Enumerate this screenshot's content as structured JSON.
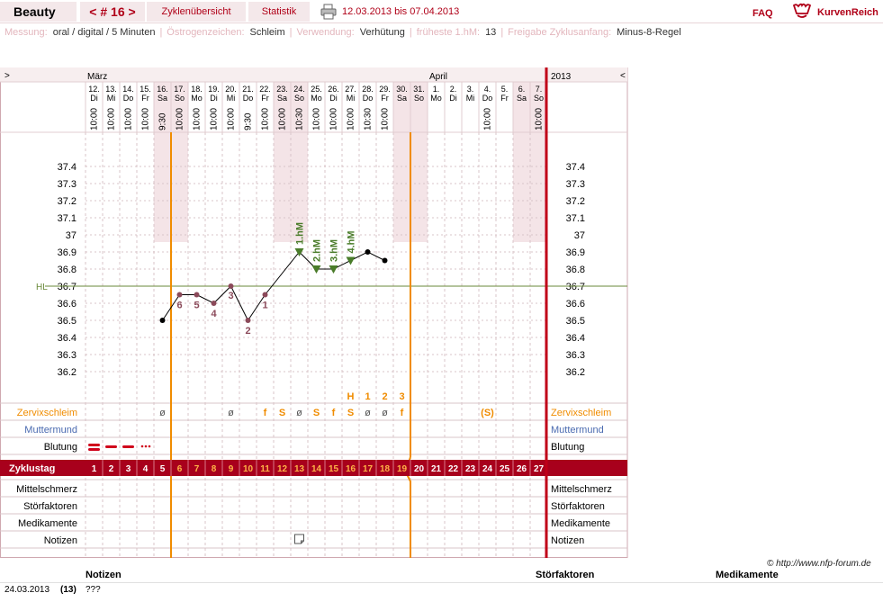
{
  "topbar": {
    "app_title": "Beauty",
    "cycle_label": "< # 16 >",
    "tab_overview": "Zyklenübersicht",
    "tab_statistics": "Statistik",
    "date_range": "12.03.2013 bis 07.04.2013",
    "faq": "FAQ",
    "logo_text": "KurvenReich"
  },
  "meta": [
    {
      "key": "Messung:",
      "value": "oral / digital / 5 Minuten"
    },
    {
      "key": "Östrogenzeichen:",
      "value": "Schleim"
    },
    {
      "key": "Verwendung:",
      "value": "Verhütung"
    },
    {
      "key": "früheste 1.hM:",
      "value": "13"
    },
    {
      "key": "Freigabe Zyklusanfang:",
      "value": "Minus-8-Regel"
    }
  ],
  "chart_data": {
    "type": "line",
    "nav_left": ">",
    "nav_right": "<",
    "year": "2013",
    "months": [
      {
        "label": "März",
        "day_index": 0
      },
      {
        "label": "April",
        "day_index": 20
      }
    ],
    "days": [
      {
        "date": "12.",
        "wd": "Di",
        "time": "10:00",
        "cd": "1",
        "weekend": false
      },
      {
        "date": "13.",
        "wd": "Mi",
        "time": "10:00",
        "cd": "2",
        "weekend": false
      },
      {
        "date": "14.",
        "wd": "Do",
        "time": "10:00",
        "cd": "3",
        "weekend": false
      },
      {
        "date": "15.",
        "wd": "Fr",
        "time": "10:00",
        "cd": "4",
        "weekend": false
      },
      {
        "date": "16.",
        "wd": "Sa",
        "time": "9:30",
        "cd": "5",
        "weekend": true
      },
      {
        "date": "17.",
        "wd": "So",
        "time": "10:00",
        "cd": "6",
        "weekend": true
      },
      {
        "date": "18.",
        "wd": "Mo",
        "time": "10:00",
        "cd": "7",
        "weekend": false
      },
      {
        "date": "19.",
        "wd": "Di",
        "time": "10:00",
        "cd": "8",
        "weekend": false
      },
      {
        "date": "20.",
        "wd": "Mi",
        "time": "10:00",
        "cd": "9",
        "weekend": false
      },
      {
        "date": "21.",
        "wd": "Do",
        "time": "9:30",
        "cd": "10",
        "weekend": false
      },
      {
        "date": "22.",
        "wd": "Fr",
        "time": "10:00",
        "cd": "11",
        "weekend": false
      },
      {
        "date": "23.",
        "wd": "Sa",
        "time": "10:00",
        "cd": "12",
        "weekend": true
      },
      {
        "date": "24.",
        "wd": "So",
        "time": "10:30",
        "cd": "13",
        "weekend": true
      },
      {
        "date": "25.",
        "wd": "Mo",
        "time": "10:00",
        "cd": "14",
        "weekend": false
      },
      {
        "date": "26.",
        "wd": "Di",
        "time": "10:00",
        "cd": "15",
        "weekend": false
      },
      {
        "date": "27.",
        "wd": "Mi",
        "time": "10:00",
        "cd": "16",
        "weekend": false
      },
      {
        "date": "28.",
        "wd": "Do",
        "time": "10:30",
        "cd": "17",
        "weekend": false
      },
      {
        "date": "29.",
        "wd": "Fr",
        "time": "10:00",
        "cd": "18",
        "weekend": false
      },
      {
        "date": "30.",
        "wd": "Sa",
        "time": "",
        "cd": "19",
        "weekend": true
      },
      {
        "date": "31.",
        "wd": "So",
        "time": "",
        "cd": "20",
        "weekend": true
      },
      {
        "date": "1.",
        "wd": "Mo",
        "time": "",
        "cd": "21",
        "weekend": false
      },
      {
        "date": "2.",
        "wd": "Di",
        "time": "",
        "cd": "22",
        "weekend": false
      },
      {
        "date": "3.",
        "wd": "Mi",
        "time": "",
        "cd": "23",
        "weekend": false
      },
      {
        "date": "4.",
        "wd": "Do",
        "time": "10:00",
        "cd": "24",
        "weekend": false
      },
      {
        "date": "5.",
        "wd": "Fr",
        "time": "",
        "cd": "25",
        "weekend": false
      },
      {
        "date": "6.",
        "wd": "Sa",
        "time": "",
        "cd": "26",
        "weekend": true
      },
      {
        "date": "7.",
        "wd": "So",
        "time": "10:00",
        "cd": "27",
        "weekend": true
      }
    ],
    "y_ticks": [
      "37.4",
      "37.3",
      "37.2",
      "37.1",
      "37",
      "36.9",
      "36.8",
      "36.7",
      "36.6",
      "36.5",
      "36.4",
      "36.3",
      "36.2"
    ],
    "ylim": [
      36.1,
      37.5
    ],
    "hl_label": "HL",
    "hl_value": 36.7,
    "temperatures": [
      null,
      null,
      null,
      null,
      36.5,
      36.65,
      36.65,
      36.6,
      36.7,
      36.5,
      36.65,
      null,
      36.9,
      36.8,
      36.8,
      36.85,
      36.9,
      36.85,
      null,
      null,
      null,
      null,
      null,
      null,
      null,
      null,
      null
    ],
    "low_labels": [
      {
        "day": 5,
        "label": "6"
      },
      {
        "day": 6,
        "label": "5"
      },
      {
        "day": 7,
        "label": "4"
      },
      {
        "day": 8,
        "label": "3"
      },
      {
        "day": 9,
        "label": "2"
      },
      {
        "day": 10,
        "label": "1"
      }
    ],
    "high_labels": [
      {
        "day": 12,
        "label": "1.hM"
      },
      {
        "day": 13,
        "label": "2.hM"
      },
      {
        "day": 14,
        "label": "3.hM"
      },
      {
        "day": 15,
        "label": "4.hM"
      }
    ],
    "mucus_peak": [
      {
        "day": 15,
        "label": "H"
      },
      {
        "day": 16,
        "label": "1"
      },
      {
        "day": 17,
        "label": "2"
      },
      {
        "day": 18,
        "label": "3"
      }
    ],
    "mucus": [
      {
        "day": 4,
        "label": "ø"
      },
      {
        "day": 8,
        "label": "ø"
      },
      {
        "day": 10,
        "label": "f"
      },
      {
        "day": 11,
        "label": "S"
      },
      {
        "day": 12,
        "label": "ø"
      },
      {
        "day": 13,
        "label": "S"
      },
      {
        "day": 14,
        "label": "f"
      },
      {
        "day": 15,
        "label": "S"
      },
      {
        "day": 16,
        "label": "ø"
      },
      {
        "day": 17,
        "label": "ø"
      },
      {
        "day": 18,
        "label": "f"
      },
      {
        "day": 23,
        "label": "(S)"
      }
    ],
    "bleeding_days": [
      {
        "day": 0,
        "level": "heavy"
      },
      {
        "day": 1,
        "level": "medium"
      },
      {
        "day": 2,
        "level": "medium"
      },
      {
        "day": 3,
        "level": "light"
      }
    ],
    "note_days": [
      12
    ],
    "cycle_day_label": "Zyklustag",
    "row_labels": {
      "mucus": "Zervixschleim",
      "cervix": "Muttermund",
      "bleeding": "Blutung",
      "pain": "Mittelschmerz",
      "disturbance": "Störfaktoren",
      "meds": "Medikamente",
      "notes": "Notizen"
    },
    "fertile_start_index": 5,
    "fertile_end_index": 18
  },
  "copyright": "© http://www.nfp-forum.de",
  "footer": {
    "col_notes": "Notizen",
    "col_disturbances": "Störfaktoren",
    "col_meds": "Medikamente",
    "rows": [
      {
        "date": "24.03.2013",
        "cycle_day": "(13)",
        "note": "???"
      }
    ]
  },
  "colors": {
    "accent": "#b00018",
    "fertile": "#f08c00",
    "high": "#4a7c2a",
    "low": "#8b4a5a",
    "weekend": "#f4e4e7"
  }
}
